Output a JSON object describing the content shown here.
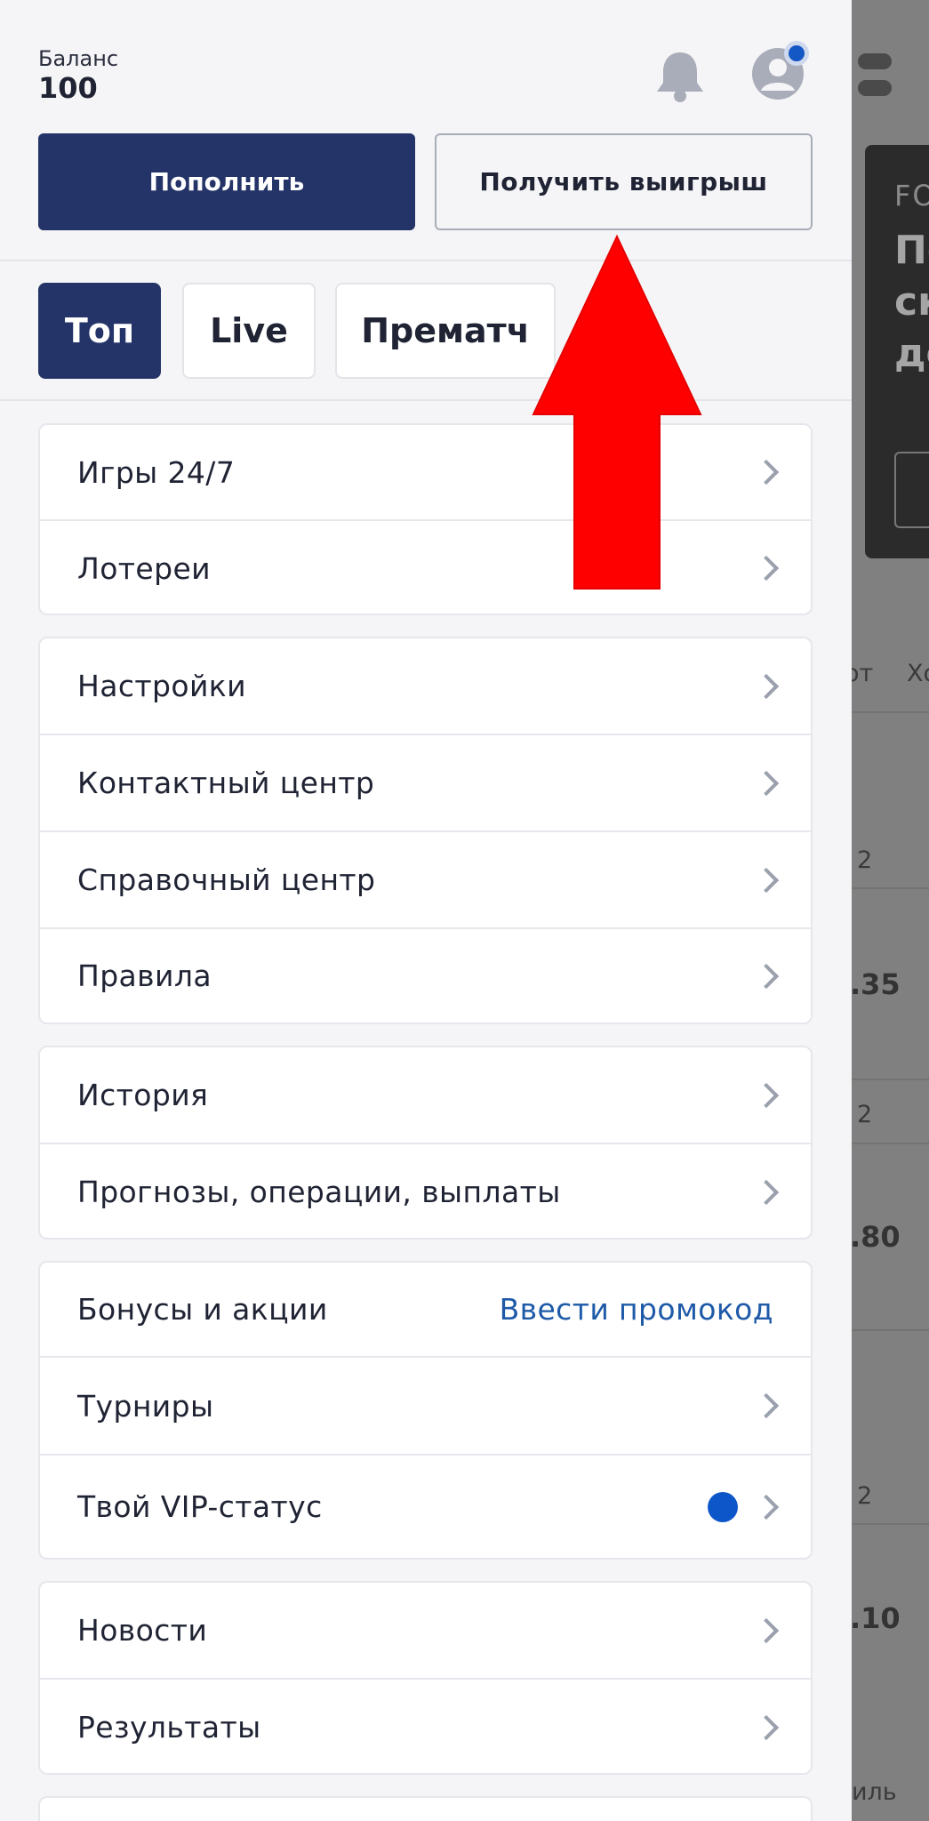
{
  "header": {
    "balance_label": "Баланс",
    "balance_value": "100",
    "icons": [
      "bell-icon",
      "profile-icon",
      "toggle-icon"
    ]
  },
  "actions": {
    "deposit_label": "Пополнить",
    "withdraw_label": "Получить выигрыш"
  },
  "tabs": [
    {
      "label": "Топ",
      "active": true
    },
    {
      "label": "Live",
      "active": false
    },
    {
      "label": "Прематч",
      "active": false
    }
  ],
  "menu": {
    "group1": [
      "Игры 24/7",
      "Лотереи"
    ],
    "group2": [
      "Настройки",
      "Контактный центр",
      "Справочный центр",
      "Правила"
    ],
    "group3": [
      "История",
      "Прогнозы, операции, выплаты"
    ],
    "group4": {
      "bonuses_label": "Бонусы и акции",
      "promo_link": "Ввести промокод",
      "tournaments_label": "Турниры",
      "vip_label": "Твой VIP-статус"
    },
    "group5": [
      "Новости",
      "Результаты"
    ]
  },
  "background": {
    "banner_tag": "FO",
    "banner_title": "По\nск\nдо",
    "tab_partial_1": "от",
    "tab_partial_2": "Хо",
    "odds_header": "2",
    "odds": [
      ".35",
      ".80",
      ".10"
    ],
    "bottom_label": "иль"
  },
  "colors": {
    "primary": "#243468",
    "link": "#1e5aa8",
    "dot": "#0d56c9",
    "annotation_arrow": "#ff0000"
  }
}
